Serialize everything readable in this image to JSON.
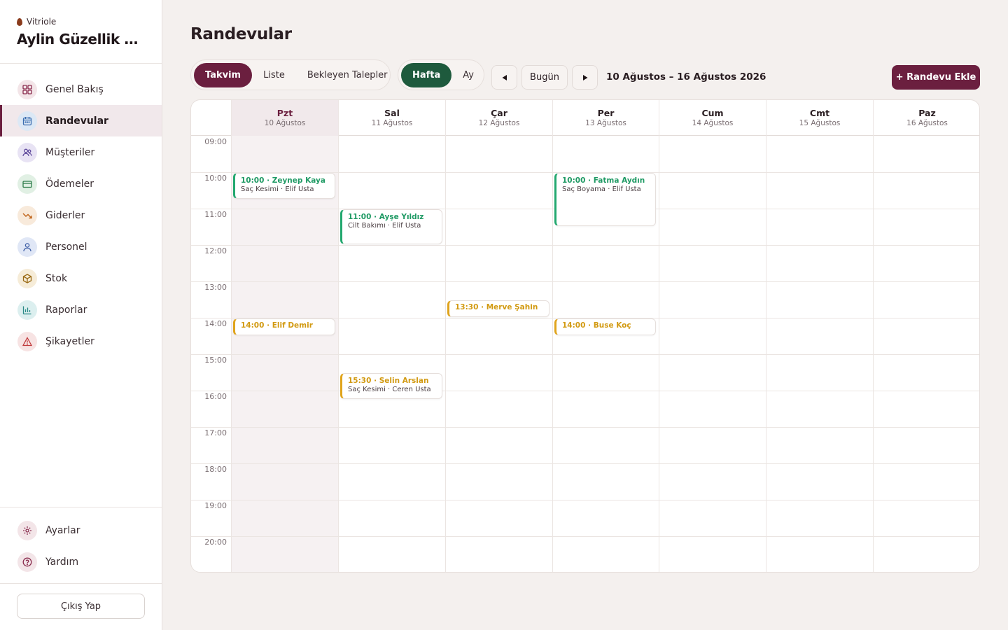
{
  "brand": {
    "small": "Vitriole",
    "name": "Aylin Güzellik Me..."
  },
  "nav": [
    {
      "label": "Genel Bakış",
      "icon": "grid-icon",
      "color": "#f3e5e8"
    },
    {
      "label": "Randevular",
      "icon": "calendar-icon",
      "color": "#dce8f5"
    },
    {
      "label": "Müşteriler",
      "icon": "users-icon",
      "color": "#e8e3f4"
    },
    {
      "label": "Ödemeler",
      "icon": "credit-card-icon",
      "color": "#e1f0e4"
    },
    {
      "label": "Giderler",
      "icon": "trending-down-icon",
      "color": "#f8eadb"
    },
    {
      "label": "Personel",
      "icon": "user-icon",
      "color": "#e0e7f6"
    },
    {
      "label": "Stok",
      "icon": "box-icon",
      "color": "#f6ecd8"
    },
    {
      "label": "Raporlar",
      "icon": "bar-chart-icon",
      "color": "#dcefef"
    },
    {
      "label": "Şikayetler",
      "icon": "alert-triangle-icon",
      "color": "#f7e3e3"
    }
  ],
  "bottom_nav": [
    {
      "label": "Ayarlar",
      "icon": "gear-icon"
    },
    {
      "label": "Yardım",
      "icon": "help-circle-icon"
    }
  ],
  "logout_label": "Çıkış Yap",
  "page_title": "Randevular",
  "view_tabs": [
    "Takvim",
    "Liste",
    "Bekleyen Talepler"
  ],
  "range_tabs": [
    "Hafta",
    "Ay"
  ],
  "today_label": "Bugün",
  "date_range": "10 Ağustos – 16 Ağustos 2026",
  "add_button": "+ Randevu Ekle",
  "colors": {
    "accent": "#6b1f3f",
    "green_tab": "#1e5a3d",
    "event_green": "#23a86f",
    "event_amber": "#e0a41c"
  },
  "days": [
    {
      "name": "Pzt",
      "date": "10 Ağustos"
    },
    {
      "name": "Sal",
      "date": "11 Ağustos"
    },
    {
      "name": "Çar",
      "date": "12 Ağustos"
    },
    {
      "name": "Per",
      "date": "13 Ağustos"
    },
    {
      "name": "Cum",
      "date": "14 Ağustos"
    },
    {
      "name": "Cmt",
      "date": "15 Ağustos"
    },
    {
      "name": "Paz",
      "date": "16 Ağustos"
    }
  ],
  "hours": [
    "09:00",
    "10:00",
    "11:00",
    "12:00",
    "13:00",
    "14:00",
    "15:00",
    "16:00",
    "17:00",
    "18:00",
    "19:00",
    "20:00"
  ],
  "events": [
    {
      "day": 0,
      "start": "10:00",
      "end": "10:45",
      "title": "10:00 · Zeynep Kaya",
      "subtitle": "Saç Kesimi · Elif Usta",
      "status": "green"
    },
    {
      "day": 0,
      "start": "14:00",
      "end": "14:30",
      "title": "14:00 · Elif Demir",
      "subtitle": "",
      "status": "amber"
    },
    {
      "day": 1,
      "start": "11:00",
      "end": "12:00",
      "title": "11:00 · Ayşe Yıldız",
      "subtitle": "Cilt Bakımı · Elif Usta",
      "status": "green"
    },
    {
      "day": 1,
      "start": "15:30",
      "end": "16:15",
      "title": "15:30 · Selin Arslan",
      "subtitle": "Saç Kesimi · Ceren Usta",
      "status": "amber"
    },
    {
      "day": 2,
      "start": "13:30",
      "end": "14:00",
      "title": "13:30 · Merve Şahin",
      "subtitle": "",
      "status": "amber"
    },
    {
      "day": 3,
      "start": "10:00",
      "end": "11:30",
      "title": "10:00 · Fatma Aydın",
      "subtitle": "Saç Boyama · Elif Usta",
      "status": "green"
    },
    {
      "day": 3,
      "start": "14:00",
      "end": "14:30",
      "title": "14:00 · Buse Koç",
      "subtitle": "",
      "status": "amber"
    }
  ]
}
